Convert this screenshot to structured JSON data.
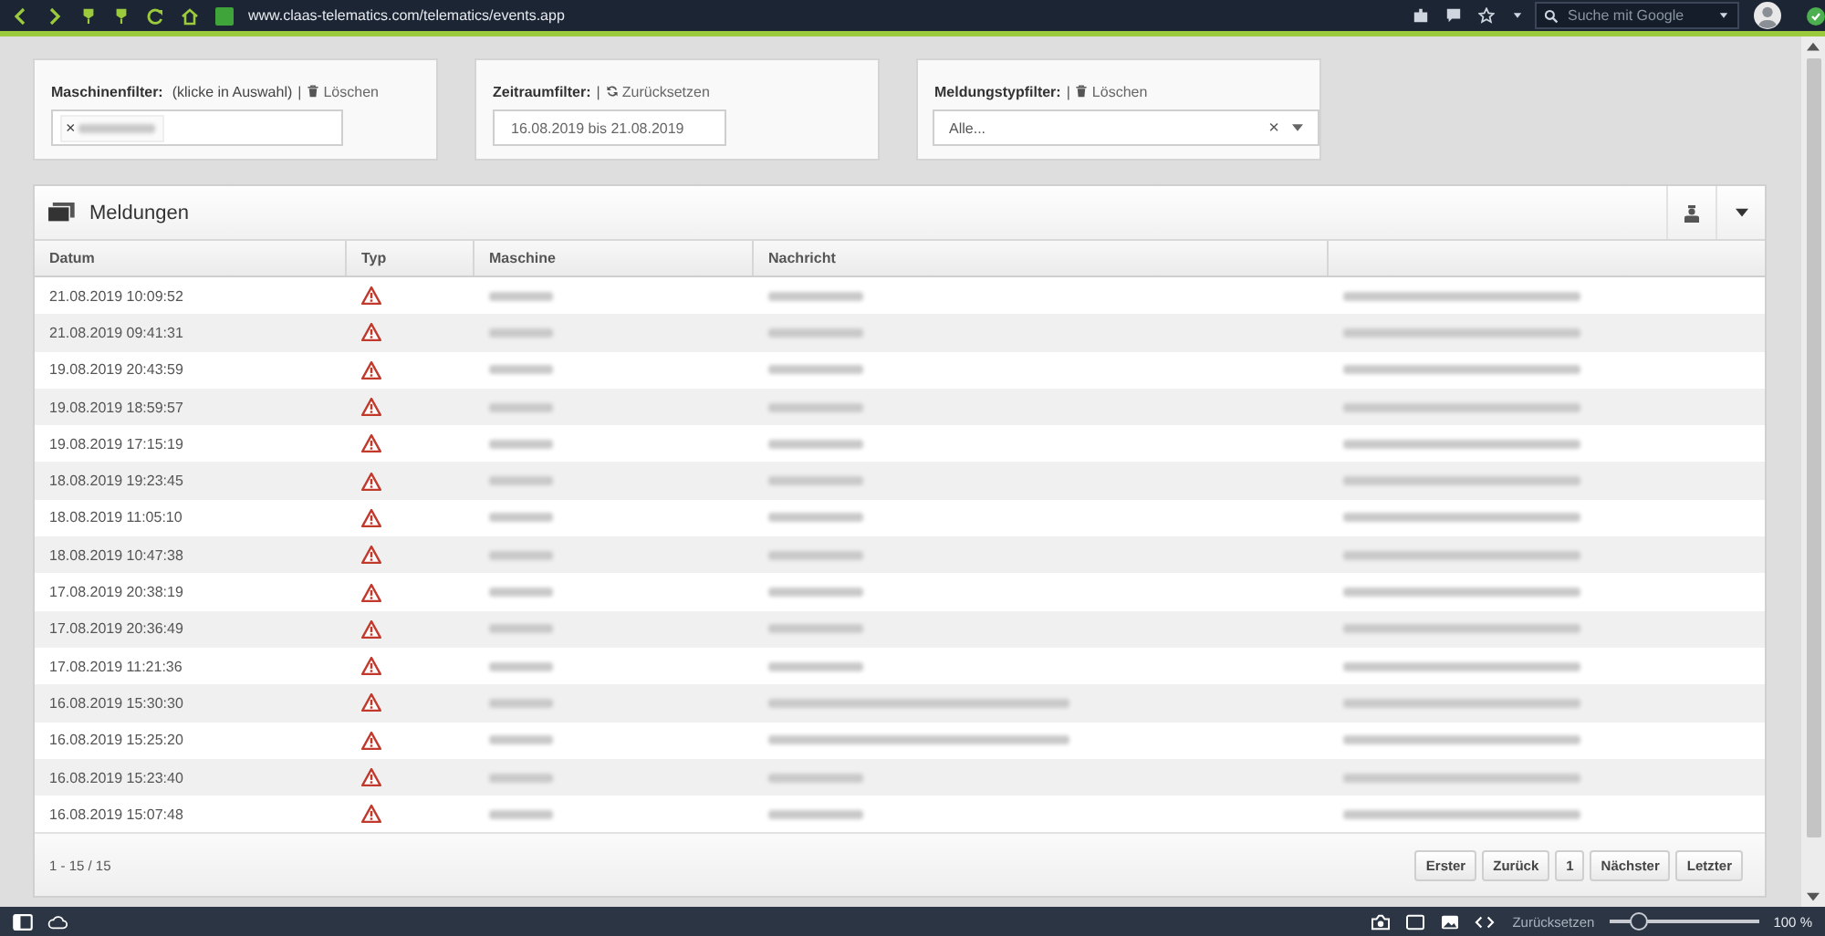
{
  "browser": {
    "url": "www.claas-telematics.com/telematics/events.app",
    "search_placeholder": "Suche mit Google"
  },
  "filters": [
    {
      "label": "Maschinenfilter:",
      "note": "(klicke in Auswahl)",
      "separator": "|",
      "action": {
        "kind": "clear",
        "label": "Löschen"
      },
      "field": {
        "kind": "tags",
        "tags": [
          {
            "remove": "×"
          }
        ]
      }
    },
    {
      "label": "Zeitraumfilter:",
      "separator": "|",
      "action": {
        "kind": "reset",
        "label": "Zurücksetzen"
      },
      "field": {
        "kind": "text",
        "value": "16.08.2019 bis 21.08.2019"
      }
    },
    {
      "label": "Meldungstypfilter:",
      "separator": "|",
      "action": {
        "kind": "clear",
        "label": "Löschen"
      },
      "field": {
        "kind": "select",
        "value": "Alle...",
        "clear": "×"
      }
    }
  ],
  "panel": {
    "title": "Meldungen",
    "table": {
      "columns": [
        "Datum",
        "Typ",
        "Maschine",
        "Nachricht"
      ],
      "rows": [
        {
          "date": "21.08.2019 10:09:52",
          "type": {
            "kind": "warning"
          },
          "message": {
            "kind": "code"
          }
        },
        {
          "date": "21.08.2019 09:41:31",
          "type": {
            "kind": "warning"
          },
          "message": {
            "kind": "code"
          }
        },
        {
          "date": "19.08.2019 20:43:59",
          "type": {
            "kind": "warning"
          },
          "message": {
            "kind": "code"
          }
        },
        {
          "date": "19.08.2019 18:59:57",
          "type": {
            "kind": "warning"
          },
          "message": {
            "kind": "code"
          }
        },
        {
          "date": "19.08.2019 17:15:19",
          "type": {
            "kind": "warning"
          },
          "message": {
            "kind": "code"
          }
        },
        {
          "date": "18.08.2019 19:23:45",
          "type": {
            "kind": "warning"
          },
          "message": {
            "kind": "code"
          }
        },
        {
          "date": "18.08.2019 11:05:10",
          "type": {
            "kind": "warning"
          },
          "message": {
            "kind": "code"
          }
        },
        {
          "date": "18.08.2019 10:47:38",
          "type": {
            "kind": "warning"
          },
          "message": {
            "kind": "code"
          }
        },
        {
          "date": "17.08.2019 20:38:19",
          "type": {
            "kind": "warning"
          },
          "message": {
            "kind": "code"
          }
        },
        {
          "date": "17.08.2019 20:36:49",
          "type": {
            "kind": "warning"
          },
          "message": {
            "kind": "code"
          }
        },
        {
          "date": "17.08.2019 11:21:36",
          "type": {
            "kind": "warning"
          },
          "message": {
            "kind": "code"
          }
        },
        {
          "date": "16.08.2019 15:30:30",
          "type": {
            "kind": "warning"
          },
          "message": {
            "kind": "text"
          }
        },
        {
          "date": "16.08.2019 15:25:20",
          "type": {
            "kind": "warning"
          },
          "message": {
            "kind": "text"
          }
        },
        {
          "date": "16.08.2019 15:23:40",
          "type": {
            "kind": "warning"
          },
          "message": {
            "kind": "code"
          }
        },
        {
          "date": "16.08.2019 15:07:48",
          "type": {
            "kind": "warning"
          },
          "message": {
            "kind": "code"
          }
        }
      ]
    },
    "footer": {
      "range": "1 - 15 / 15",
      "pagination": [
        "Erster",
        "Zurück",
        "1",
        "Nächster",
        "Letzter"
      ]
    }
  },
  "status_bar": {
    "reset": "Zurücksetzen",
    "zoom": {
      "level": 0.2,
      "reading": "100 %"
    }
  }
}
